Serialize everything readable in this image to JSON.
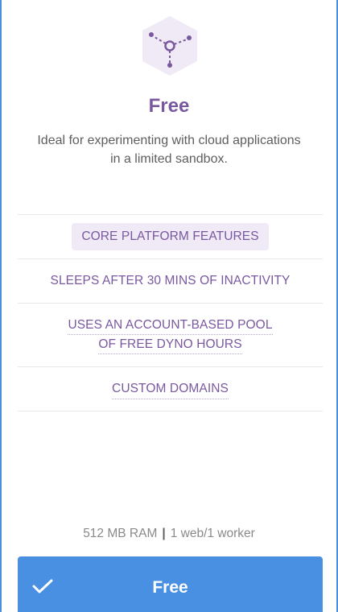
{
  "plan": {
    "icon": "dyno-node-icon",
    "title": "Free",
    "description": "Ideal for experimenting with cloud applications in a limited sandbox."
  },
  "features": [
    {
      "label": "CORE PLATFORM FEATURES"
    },
    {
      "label": "SLEEPS AFTER 30 MINS OF INACTIVITY"
    },
    {
      "line1": "USES AN ACCOUNT-BASED POOL",
      "line2": "OF FREE DYNO HOURS"
    },
    {
      "label": "CUSTOM DOMAINS"
    }
  ],
  "specs": {
    "ram": "512 MB RAM",
    "separator": "|",
    "workers": "1 web/1 worker"
  },
  "cta": {
    "icon": "checkmark-icon",
    "label": "Free"
  },
  "colors": {
    "accent_purple": "#79589f",
    "button_blue": "#4a90e2",
    "pill_bg": "#efeaf5"
  }
}
